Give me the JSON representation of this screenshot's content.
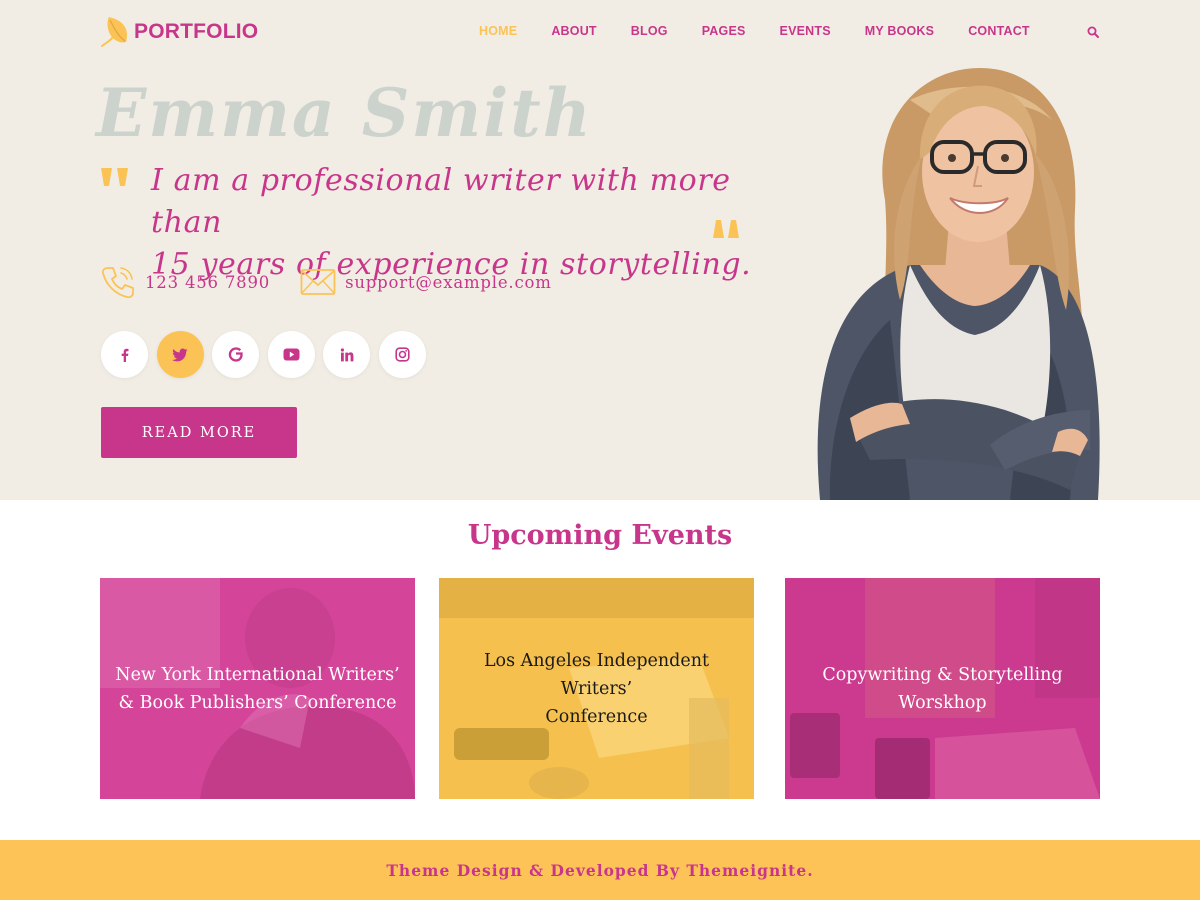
{
  "brand": {
    "name": "PORTFOLIO",
    "logo_icon": "feather-icon"
  },
  "nav": {
    "items": [
      {
        "label": "HOME",
        "active": true
      },
      {
        "label": "ABOUT"
      },
      {
        "label": "BLOG"
      },
      {
        "label": "PAGES"
      },
      {
        "label": "EVENTS"
      },
      {
        "label": "MY BOOKS"
      },
      {
        "label": "CONTACT"
      }
    ],
    "search_icon": "search-icon"
  },
  "hero": {
    "name": "Emma Smith",
    "quote_line1": "I am a professional writer with more than",
    "quote_line2": "15 years of experience in storytelling.",
    "phone": "123 456 7890",
    "email": "support@example.com",
    "socials": [
      {
        "icon": "facebook-icon"
      },
      {
        "icon": "twitter-icon",
        "active": true
      },
      {
        "icon": "google-icon"
      },
      {
        "icon": "youtube-icon"
      },
      {
        "icon": "linkedin-icon"
      },
      {
        "icon": "instagram-icon"
      }
    ],
    "cta_label": "READ MORE"
  },
  "events": {
    "title": "Upcoming Events",
    "items": [
      {
        "line1": "New York International Writers’",
        "line2": "& Book Publishers’ Conference",
        "overlay": "#d4459a"
      },
      {
        "line1": "Los Angeles Independent Writers’",
        "line2": "Conference",
        "overlay": "#f6c04e"
      },
      {
        "line1": "Copywriting & Storytelling",
        "line2": "Worskhop",
        "overlay": "#cc3a8f"
      }
    ]
  },
  "footer": {
    "text": "Theme Design & Developed By Themeignite."
  },
  "colors": {
    "primary": "#c8368b",
    "accent": "#fbc356",
    "hero_bg": "#f2ede4",
    "footer_bg": "#fec357"
  }
}
